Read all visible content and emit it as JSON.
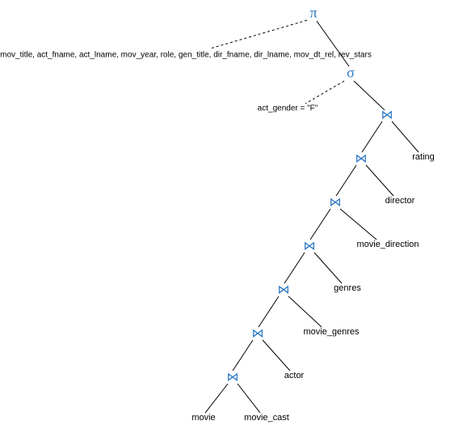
{
  "operators": {
    "pi": "π",
    "sigma": "σ",
    "join": "⋈"
  },
  "projection_list": "mov_title, act_fname, act_lname, mov_year, role, gen_title, dir_fname, dir_lname, mov_dt_rel, rev_stars",
  "selection_predicate": "act_gender = \"F\"",
  "relations": {
    "rating": "rating",
    "director": "director",
    "movie_direction": "movie_direction",
    "genres": "genres",
    "movie_genres": "movie_genres",
    "actor": "actor",
    "movie": "movie",
    "movie_cast": "movie_cast"
  }
}
